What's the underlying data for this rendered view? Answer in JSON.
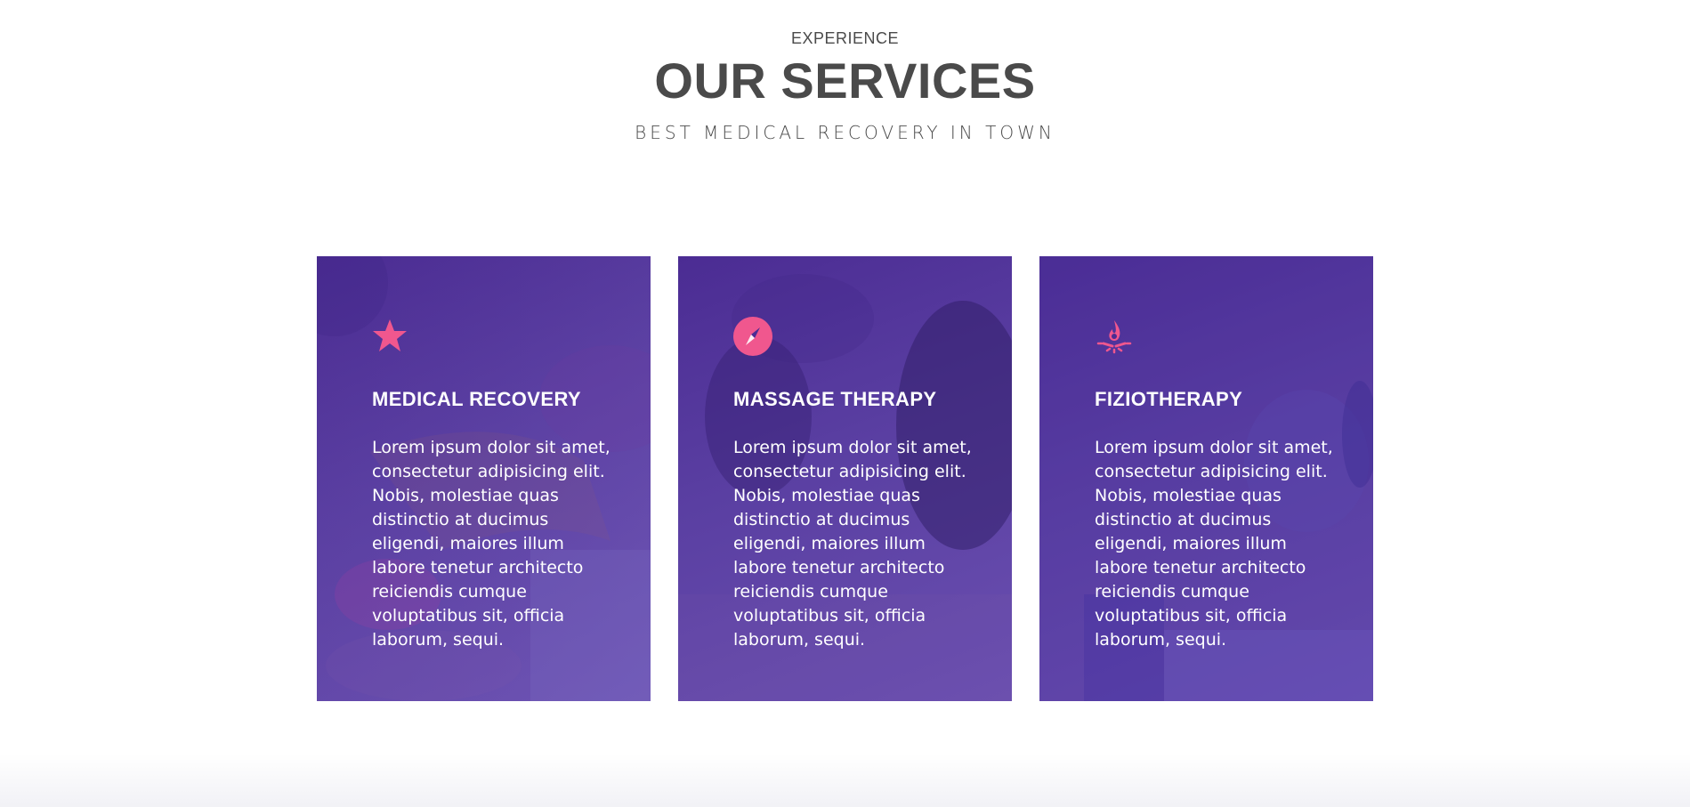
{
  "section": {
    "kicker": "EXPERIENCE",
    "title": "OUR SERVICES",
    "subtitle": "BEST MEDICAL RECOVERY IN TOWN"
  },
  "colors": {
    "accent": "#f0578e",
    "card_gradient_start": "#4b2c93",
    "card_gradient_end": "#6a4fb0",
    "text_dark": "#4a4a4a"
  },
  "cards": [
    {
      "icon": "star-icon",
      "title": "MEDICAL RECOVERY",
      "text": "Lorem ipsum dolor sit amet, consectetur adipisicing elit. Nobis, molestiae quas distinctio at ducimus eligendi, maiores illum labore tenetur architecto reiciendis cumque voluptatibus sit, officia laborum, sequi."
    },
    {
      "icon": "compass-icon",
      "title": "MASSAGE THERAPY",
      "text": "Lorem ipsum dolor sit amet, consectetur adipisicing elit. Nobis, molestiae quas distinctio at ducimus eligendi, maiores illum labore tenetur architecto reiciendis cumque voluptatibus sit, officia laborum, sequi."
    },
    {
      "icon": "campfire-icon",
      "title": "FIZIOTHERAPY",
      "text": "Lorem ipsum dolor sit amet, consectetur adipisicing elit. Nobis, molestiae quas distinctio at ducimus eligendi, maiores illum labore tenetur architecto reiciendis cumque voluptatibus sit, officia laborum, sequi."
    }
  ]
}
